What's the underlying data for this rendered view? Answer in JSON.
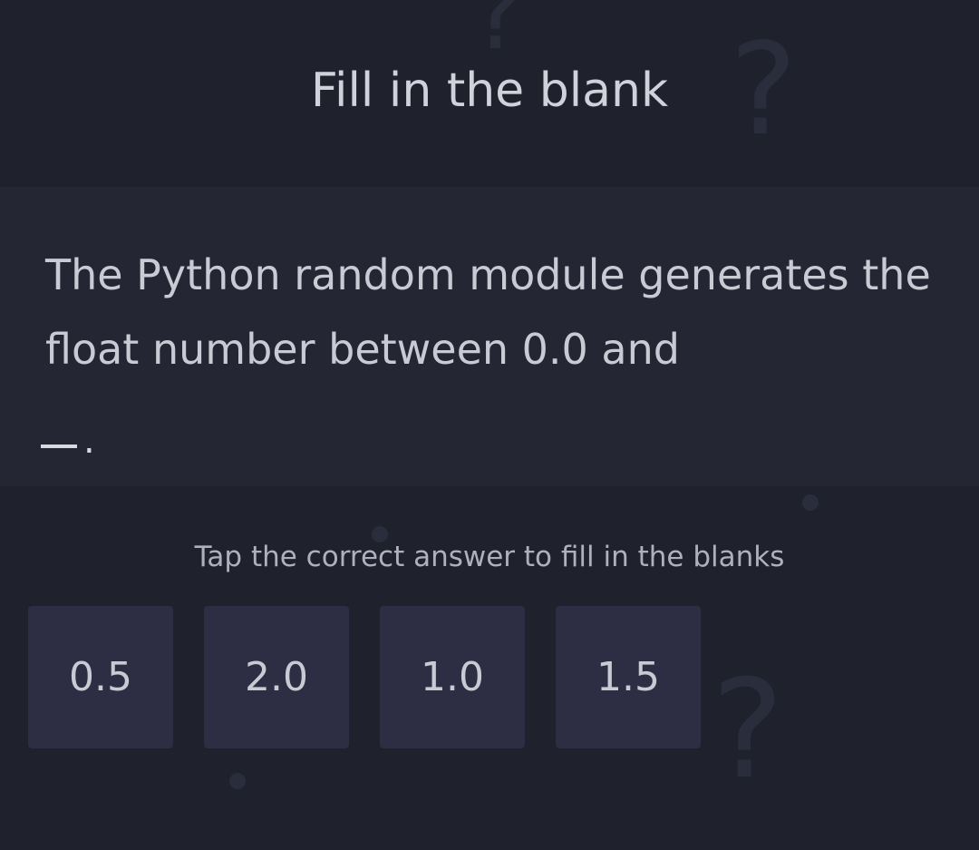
{
  "header": {
    "title": "Fill in the blank"
  },
  "question": {
    "text": "The Python random module generates the float number between 0.0 and",
    "blank_suffix": "."
  },
  "instruction": "Tap the correct answer to fill in the blanks",
  "options": [
    {
      "label": "0.5"
    },
    {
      "label": "2.0"
    },
    {
      "label": "1.0"
    },
    {
      "label": "1.5"
    }
  ],
  "colors": {
    "background": "#1f212d",
    "panel": "#242633",
    "option_tile": "#2d2e43",
    "text": "#c9cad3"
  },
  "decorations": {
    "glyph": "?"
  }
}
